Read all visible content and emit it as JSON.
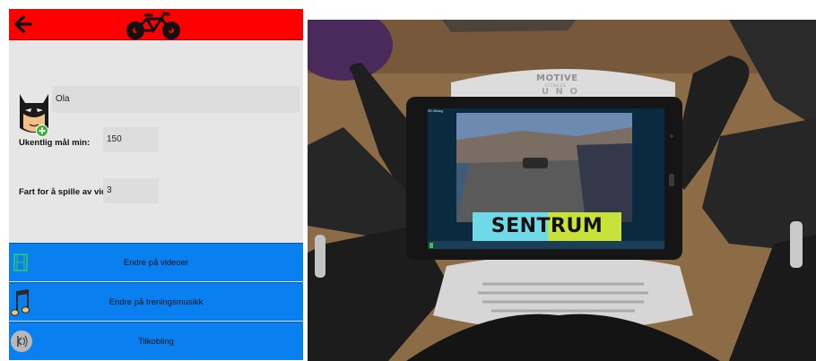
{
  "app": {
    "profile": {
      "name": "Ola",
      "goal_label": "Ukentlig mål min:",
      "goal_value": "150",
      "speed_label": "Fart for å spille av video:",
      "speed_value": "3"
    },
    "menu": [
      {
        "label": "Endre på videoer",
        "icon": "film-icon"
      },
      {
        "label": "Endre på treningsmusikk",
        "icon": "music-note-icon"
      },
      {
        "label": "Tilkobling",
        "icon": "connection-icon"
      }
    ],
    "colors": {
      "topbar": "#ff0000",
      "menu": "#0a80f0",
      "background": "#e9e9e9"
    }
  },
  "photo": {
    "brand": {
      "line1": "MOTIVE",
      "line2": "FITNESS",
      "line3": "U N O"
    },
    "tablet_status": "SB Uthaug",
    "sentrum_label": "SENTRUM"
  }
}
